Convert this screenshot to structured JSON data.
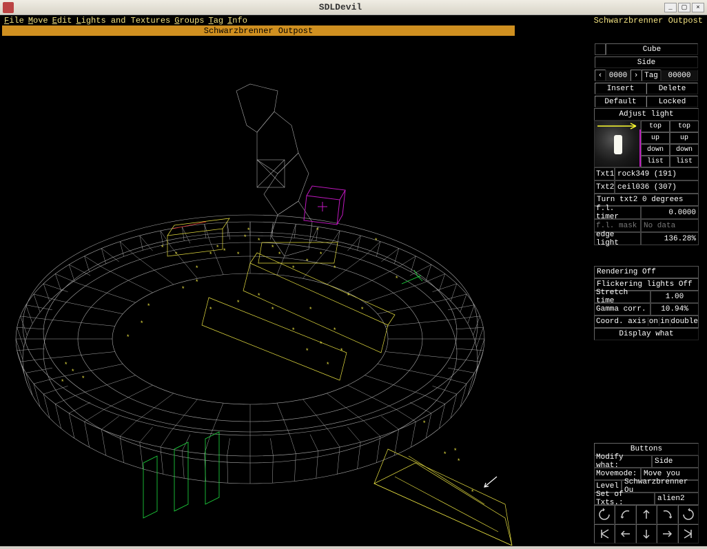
{
  "window": {
    "title": "SDLDevil"
  },
  "menu": {
    "items": [
      "File",
      "Move",
      "Edit",
      "Lights and Textures",
      "Groups",
      "Tag",
      "Info"
    ],
    "right_title": "Schwarzbrenner Outpost"
  },
  "tab": {
    "title": "Schwarzbrenner Outpost"
  },
  "panel": {
    "hdr1": "Cube",
    "hdr2": "Side",
    "nav": {
      "left": "‹",
      "val": "0000",
      "right": "›",
      "tag_label": "Tag",
      "tag_val": "00000"
    },
    "row_a": [
      "Insert",
      "Delete"
    ],
    "row_b": [
      "Default",
      "Locked"
    ],
    "adjust": "Adjust light",
    "arrow_top": "top",
    "mini": [
      [
        "top",
        "top"
      ],
      [
        "up",
        "up"
      ],
      [
        "down",
        "down"
      ],
      [
        "list",
        "list"
      ]
    ],
    "txt1_k": "Txt1",
    "txt1_v": "rock349 (191)",
    "txt2_k": "Txt2",
    "txt2_v": "ceil036 (307)",
    "turn": "Turn txt2 0 degrees",
    "fl_timer_k": "f.l. timer",
    "fl_timer_v": "0.0000",
    "fl_mask_k": "f.l. mask",
    "fl_mask_v": "No data",
    "edge_k": "edge light",
    "edge_v": "136.28%"
  },
  "sect2": {
    "rendering": "Rendering Off",
    "flicker": "Flickering lights Off",
    "stretch_k": "Stretch time",
    "stretch_v": "1.00",
    "gamma_k": "Gamma corr.",
    "gamma_v": "10.94%",
    "coord": {
      "pre": "Coord. axis",
      "a": "on",
      "b": "in",
      "c": "double"
    },
    "display": "Display what"
  },
  "btm": {
    "hdr": "Buttons",
    "modify_k": "Modify what:",
    "modify_v": "Side",
    "move_k": "Movemode:",
    "move_v": "Move you",
    "level_k": "Level",
    "level_v": "Schwarzbrenner Ou",
    "txts_k": "Set of Txts.:",
    "txts_v": "alien2"
  }
}
